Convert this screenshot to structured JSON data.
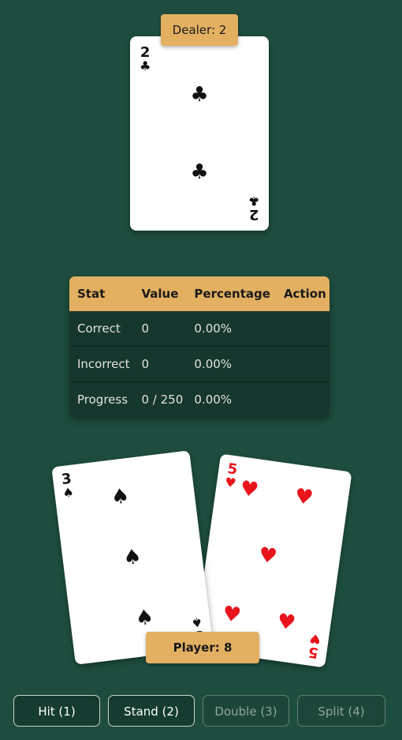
{
  "dealer": {
    "label": "Dealer: 2",
    "card": {
      "rank": "2",
      "suit": "♣",
      "color": "#111111"
    }
  },
  "stats": {
    "headers": [
      "Stat",
      "Value",
      "Percentage",
      "Action"
    ],
    "rows": [
      {
        "stat": "Correct",
        "value": "0",
        "percentage": "0.00%",
        "action": ""
      },
      {
        "stat": "Incorrect",
        "value": "0",
        "percentage": "0.00%",
        "action": ""
      },
      {
        "stat": "Progress",
        "value": "0 / 250",
        "percentage": "0.00%",
        "action": ""
      }
    ]
  },
  "player": {
    "label": "Player: 8",
    "cards": [
      {
        "rank": "3",
        "suit": "♠",
        "color": "#111111"
      },
      {
        "rank": "5",
        "suit": "♥",
        "color": "#e8131b"
      }
    ]
  },
  "actions": {
    "hit": "Hit (1)",
    "stand": "Stand (2)",
    "double": "Double (3)",
    "split": "Split (4)"
  },
  "colors": {
    "table_bg": "#1e4d3f",
    "accent": "#e3b062",
    "panel": "#15372d"
  }
}
